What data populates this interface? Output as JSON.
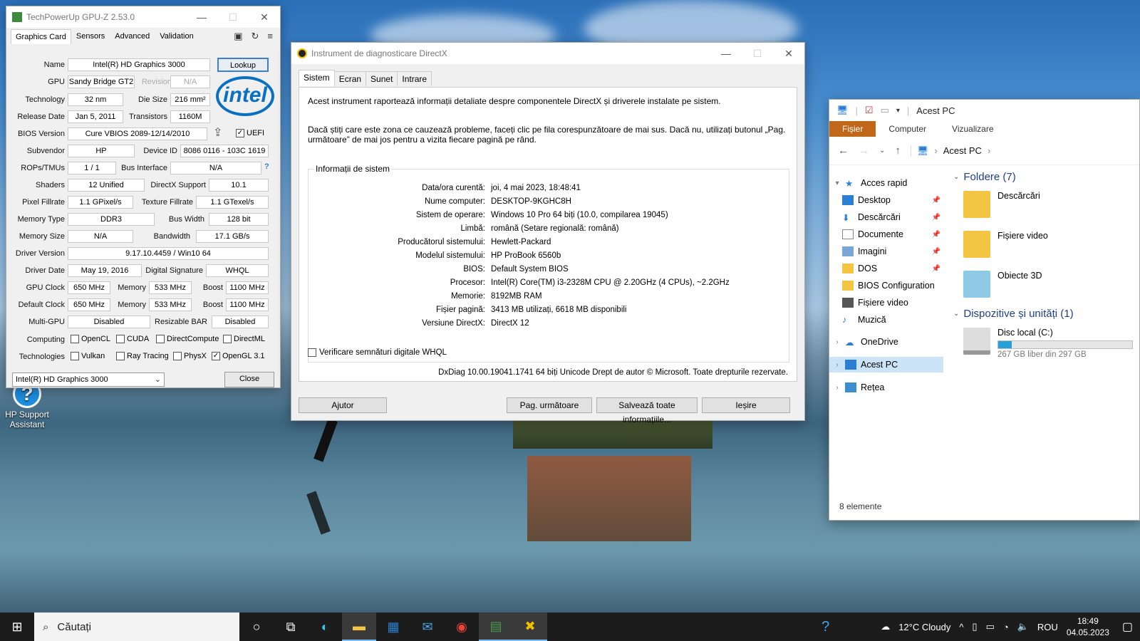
{
  "desktop": {
    "icon_label": "HP Support Assistant"
  },
  "gpuz": {
    "title": "TechPowerUp GPU-Z 2.53.0",
    "tabs": [
      "Graphics Card",
      "Sensors",
      "Advanced",
      "Validation"
    ],
    "labels": {
      "name": "Name",
      "gpu": "GPU",
      "revision": "Revision",
      "technology": "Technology",
      "die_size": "Die Size",
      "release_date": "Release Date",
      "transistors": "Transistors",
      "bios_version": "BIOS Version",
      "uefi": "UEFI",
      "subvendor": "Subvendor",
      "device_id": "Device ID",
      "rops": "ROPs/TMUs",
      "bus_interface": "Bus Interface",
      "shaders": "Shaders",
      "directx": "DirectX Support",
      "pixel_fillrate": "Pixel Fillrate",
      "texture_fillrate": "Texture Fillrate",
      "memory_type": "Memory Type",
      "bus_width": "Bus Width",
      "memory_size": "Memory Size",
      "bandwidth": "Bandwidth",
      "driver_version": "Driver Version",
      "driver_date": "Driver Date",
      "digital_signature": "Digital Signature",
      "gpu_clock": "GPU Clock",
      "memory": "Memory",
      "boost": "Boost",
      "default_clock": "Default Clock",
      "multi_gpu": "Multi-GPU",
      "resizable_bar": "Resizable BAR",
      "computing": "Computing",
      "technologies": "Technologies"
    },
    "values": {
      "name": "Intel(R) HD Graphics 3000",
      "gpu": "Sandy Bridge GT2",
      "revision": "N/A",
      "technology": "32 nm",
      "die_size": "216 mm²",
      "release_date": "Jan 5, 2011",
      "transistors": "1160M",
      "bios_version": "Cure VBIOS 2089-12/14/2010",
      "subvendor": "HP",
      "device_id": "8086 0116 - 103C 1619",
      "rops": "1 / 1",
      "bus_interface": "N/A",
      "shaders": "12 Unified",
      "directx": "10.1",
      "pixel_fillrate": "1.1 GPixel/s",
      "texture_fillrate": "1.1 GTexel/s",
      "memory_type": "DDR3",
      "bus_width": "128 bit",
      "memory_size": "N/A",
      "bandwidth": "17.1 GB/s",
      "driver_version": "9.17.10.4459 / Win10 64",
      "driver_date": "May 19, 2016",
      "digital_signature": "WHQL",
      "gpu_clock": "650 MHz",
      "gpu_memory": "533 MHz",
      "gpu_boost": "1100 MHz",
      "default_clock": "650 MHz",
      "default_memory": "533 MHz",
      "default_boost": "1100 MHz",
      "multi_gpu": "Disabled",
      "resizable_bar": "Disabled"
    },
    "computing": [
      {
        "label": "OpenCL",
        "checked": false
      },
      {
        "label": "CUDA",
        "checked": false
      },
      {
        "label": "DirectCompute",
        "checked": false
      },
      {
        "label": "DirectML",
        "checked": false
      }
    ],
    "technologies": [
      {
        "label": "Vulkan",
        "checked": false
      },
      {
        "label": "Ray Tracing",
        "checked": false
      },
      {
        "label": "PhysX",
        "checked": false
      },
      {
        "label": "OpenGL 3.1",
        "checked": true
      }
    ],
    "lookup_label": "Lookup",
    "logo_text": "intel",
    "help_glyph": "?",
    "selected_gpu": "Intel(R) HD Graphics 3000",
    "close_label": "Close"
  },
  "dxdiag": {
    "title": "Instrument de diagnosticare DirectX",
    "tabs": [
      "Sistem",
      "Ecran",
      "Sunet",
      "Intrare"
    ],
    "intro": "Acest instrument raportează informații detaliate despre componentele DirectX și driverele instalate pe sistem.",
    "hint": "Dacă știți care este zona ce cauzează probleme, faceți clic pe fila corespunzătoare de mai sus. Dacă nu, utilizați butonul „Pag. următoare” de mai jos pentru a vizita fiecare pagină pe rând.",
    "group_title": "Informații de sistem",
    "rows": [
      {
        "k": "Data/ora curentă:",
        "v": "joi, 4 mai 2023, 18:48:41"
      },
      {
        "k": "Nume computer:",
        "v": "DESKTOP-9KGHC8H"
      },
      {
        "k": "Sistem de operare:",
        "v": "Windows 10 Pro 64 biți (10.0, compilarea 19045)"
      },
      {
        "k": "Limbă:",
        "v": "română (Setare regională: română)"
      },
      {
        "k": "Producătorul sistemului:",
        "v": "Hewlett-Packard"
      },
      {
        "k": "Modelul sistemului:",
        "v": "HP ProBook 6560b"
      },
      {
        "k": "BIOS:",
        "v": "Default System BIOS"
      },
      {
        "k": "Procesor:",
        "v": "Intel(R) Core(TM) i3-2328M CPU @ 2.20GHz (4 CPUs), ~2.2GHz"
      },
      {
        "k": "Memorie:",
        "v": "8192MB RAM"
      },
      {
        "k": "Fișier pagină:",
        "v": "3413 MB utilizați, 6618 MB disponibili"
      },
      {
        "k": "Versiune DirectX:",
        "v": "DirectX 12"
      }
    ],
    "whql_label": "Verificare semnături digitale WHQL",
    "footer": "DxDiag 10.00.19041.1741 64 biți Unicode  Drept de autor © Microsoft. Toate drepturile rezervate.",
    "buttons": {
      "help": "Ajutor",
      "next": "Pag. următoare",
      "save": "Salvează toate informațiile...",
      "exit": "Ieșire"
    }
  },
  "explorer": {
    "title": "Acest PC",
    "ribbon": [
      "Fișier",
      "Computer",
      "Vizualizare"
    ],
    "address": "Acest PC",
    "sidebar": [
      {
        "label": "Acces rapid",
        "icon": "star-icon",
        "pinned": false,
        "indent": 0
      },
      {
        "label": "Desktop",
        "icon": "desktop-icon",
        "pinned": true,
        "indent": 1
      },
      {
        "label": "Descărcări",
        "icon": "download-icon",
        "pinned": true,
        "indent": 1
      },
      {
        "label": "Documente",
        "icon": "document-icon",
        "pinned": true,
        "indent": 1
      },
      {
        "label": "Imagini",
        "icon": "image-icon",
        "pinned": true,
        "indent": 1
      },
      {
        "label": "DOS",
        "icon": "folder-icon",
        "pinned": true,
        "indent": 1
      },
      {
        "label": "BIOS Configuration",
        "icon": "folder-icon",
        "pinned": false,
        "indent": 1
      },
      {
        "label": "Fișiere video",
        "icon": "video-icon",
        "pinned": false,
        "indent": 1
      },
      {
        "label": "Muzică",
        "icon": "music-icon",
        "pinned": false,
        "indent": 1
      },
      {
        "label": "OneDrive",
        "icon": "cloud-icon",
        "pinned": false,
        "indent": 0
      },
      {
        "label": "Acest PC",
        "icon": "computer-icon",
        "pinned": false,
        "indent": 0
      },
      {
        "label": "Rețea",
        "icon": "network-icon",
        "pinned": false,
        "indent": 0
      }
    ],
    "folders_header": "Foldere (7)",
    "folders": [
      "Descărcări",
      "Fișiere video",
      "Obiecte 3D"
    ],
    "devices_header": "Dispozitive și unități (1)",
    "drive": {
      "name": "Disc local (C:)",
      "free": "267 GB liber din 297 GB",
      "used_fraction": 0.1
    },
    "status": "8 elemente"
  },
  "taskbar": {
    "search_placeholder": "Căutați",
    "weather": "12°C  Cloudy",
    "language": "ROU",
    "time": "18:49",
    "date": "04.05.2023"
  }
}
